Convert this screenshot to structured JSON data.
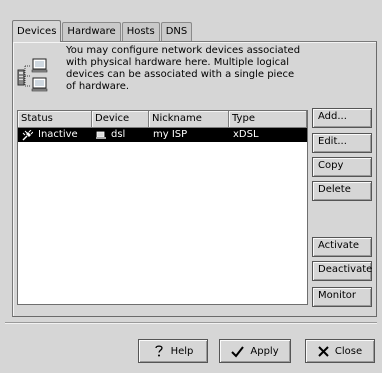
{
  "tabs": [
    {
      "label": "Devices",
      "active": true
    },
    {
      "label": "Hardware",
      "active": false
    },
    {
      "label": "Hosts",
      "active": false
    },
    {
      "label": "DNS",
      "active": false
    }
  ],
  "description": "You may configure network devices associated with physical hardware here. Multiple logical devices can be associated with a single piece of hardware.",
  "table": {
    "columns": [
      "Status",
      "Device",
      "Nickname",
      "Type"
    ],
    "rows": [
      {
        "status": "Inactive",
        "device": "dsl",
        "nickname": "my ISP",
        "type": "xDSL",
        "selected": true
      }
    ]
  },
  "side_buttons": {
    "add": "Add...",
    "edit": "Edit...",
    "copy": "Copy",
    "delete": "Delete",
    "activate": "Activate",
    "deactivate": "Deactivate",
    "monitor": "Monitor"
  },
  "bottom_buttons": {
    "help": "Help",
    "apply": "Apply",
    "close": "Close"
  },
  "colors": {
    "window_bg": "#d6d6d6",
    "selection_bg": "#000000",
    "selection_fg": "#ffffff"
  }
}
